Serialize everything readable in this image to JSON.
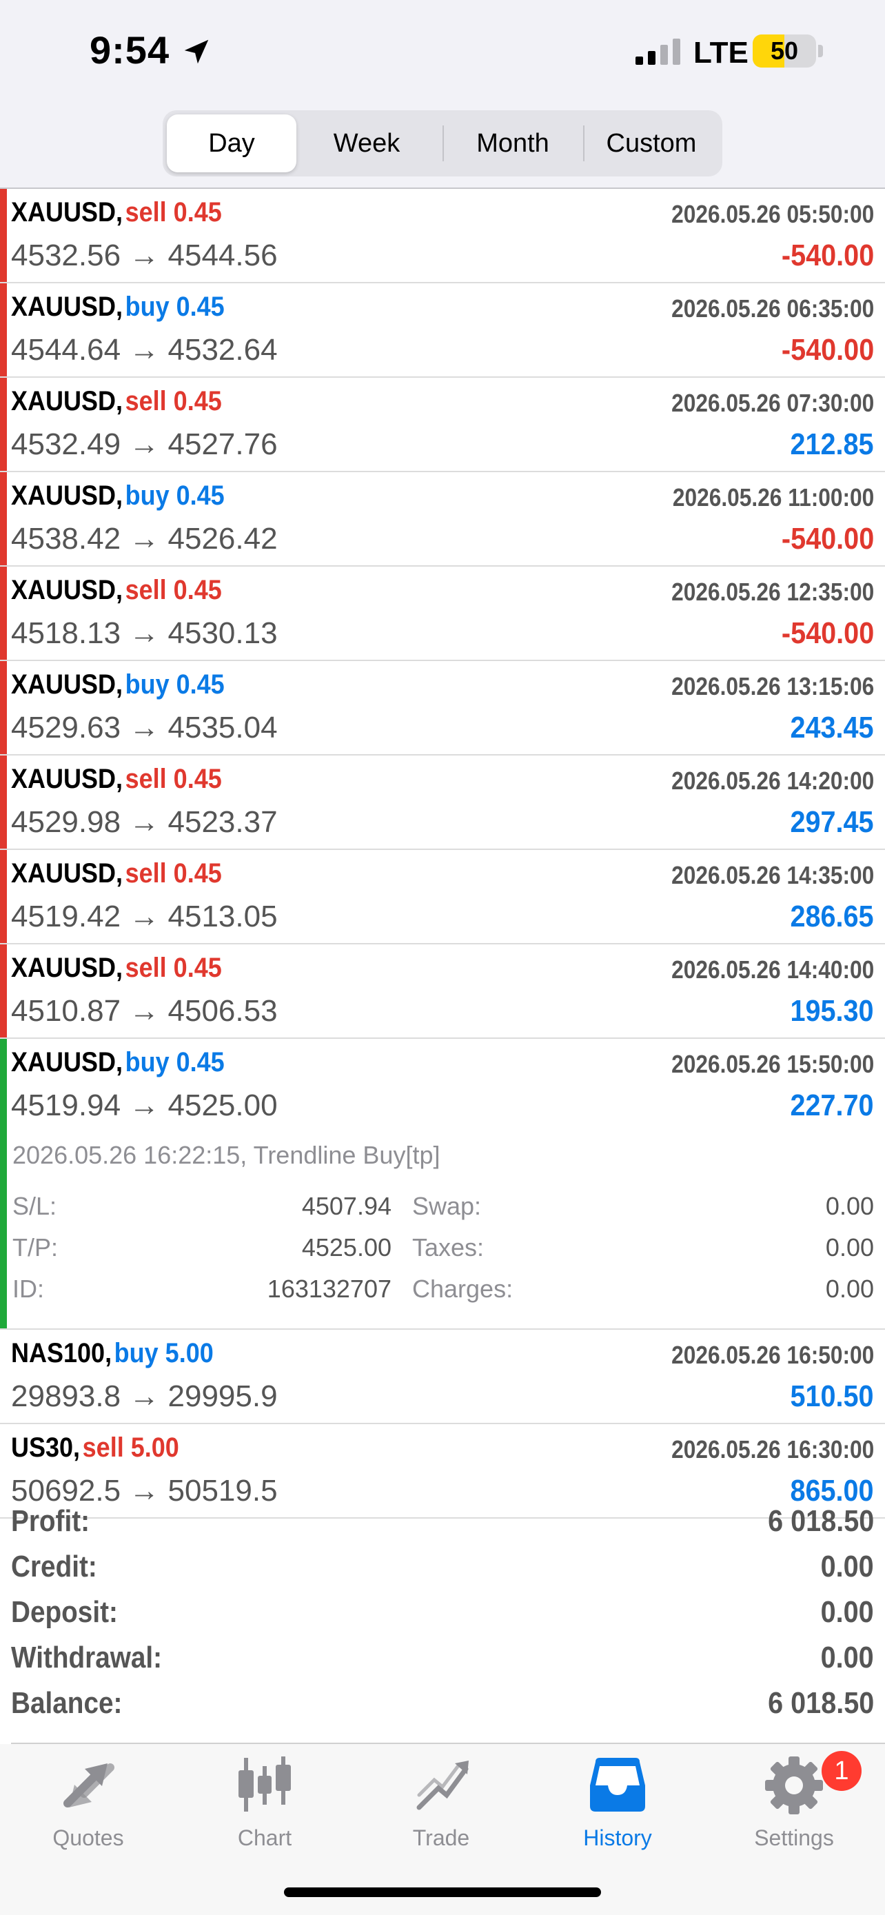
{
  "status_bar": {
    "time": "9:54",
    "network": "LTE",
    "battery": "50",
    "battery_level": 0.5
  },
  "periods": [
    {
      "label": "Day",
      "active": true
    },
    {
      "label": "Week",
      "active": false
    },
    {
      "label": "Month",
      "active": false
    },
    {
      "label": "Custom",
      "active": false
    }
  ],
  "deals": [
    {
      "symbol": "XAUUSD,",
      "side": "sell 0.45",
      "side_color": "red",
      "time": "2026.05.26 05:50:00",
      "prices": "4532.56 → 4544.56",
      "profit": "-540.00",
      "profit_color": "red",
      "bar": "#e0382e"
    },
    {
      "symbol": "XAUUSD,",
      "side": "buy 0.45",
      "side_color": "blue",
      "time": "2026.05.26 06:35:00",
      "prices": "4544.64 → 4532.64",
      "profit": "-540.00",
      "profit_color": "red",
      "bar": "#e0382e"
    },
    {
      "symbol": "XAUUSD,",
      "side": "sell 0.45",
      "side_color": "red",
      "time": "2026.05.26 07:30:00",
      "prices": "4532.49 → 4527.76",
      "profit": "212.85",
      "profit_color": "blue",
      "bar": "#e0382e"
    },
    {
      "symbol": "XAUUSD,",
      "side": "buy 0.45",
      "side_color": "blue",
      "time": "2026.05.26 11:00:00",
      "prices": "4538.42 → 4526.42",
      "profit": "-540.00",
      "profit_color": "red",
      "bar": "#e0382e"
    },
    {
      "symbol": "XAUUSD,",
      "side": "sell 0.45",
      "side_color": "red",
      "time": "2026.05.26 12:35:00",
      "prices": "4518.13 → 4530.13",
      "profit": "-540.00",
      "profit_color": "red",
      "bar": "#e0382e"
    },
    {
      "symbol": "XAUUSD,",
      "side": "buy 0.45",
      "side_color": "blue",
      "time": "2026.05.26 13:15:06",
      "prices": "4529.63 → 4535.04",
      "profit": "243.45",
      "profit_color": "blue",
      "bar": "#e0382e"
    },
    {
      "symbol": "XAUUSD,",
      "side": "sell 0.45",
      "side_color": "red",
      "time": "2026.05.26 14:20:00",
      "prices": "4529.98 → 4523.37",
      "profit": "297.45",
      "profit_color": "blue",
      "bar": "#e0382e"
    },
    {
      "symbol": "XAUUSD,",
      "side": "sell 0.45",
      "side_color": "red",
      "time": "2026.05.26 14:35:00",
      "prices": "4519.42 → 4513.05",
      "profit": "286.65",
      "profit_color": "blue",
      "bar": "#e0382e"
    },
    {
      "symbol": "XAUUSD,",
      "side": "sell 0.45",
      "side_color": "red",
      "time": "2026.05.26 14:40:00",
      "prices": "4510.87 → 4506.53",
      "profit": "195.30",
      "profit_color": "blue",
      "bar": "#e0382e"
    },
    {
      "symbol": "XAUUSD,",
      "side": "buy 0.45",
      "side_color": "blue",
      "time": "2026.05.26 15:50:00",
      "prices": "4519.94 → 4525.00",
      "profit": "227.70",
      "profit_color": "blue",
      "bar": "#1fa93a",
      "expanded": true
    },
    {
      "symbol": "NAS100,",
      "side": "buy 5.00",
      "side_color": "blue",
      "time": "2026.05.26 16:50:00",
      "prices": "29893.8 → 29995.9",
      "profit": "510.50",
      "profit_color": "blue",
      "bar": ""
    },
    {
      "symbol": "US30,",
      "side": "sell 5.00",
      "side_color": "red",
      "time": "2026.05.26 16:30:00",
      "prices": "50692.5 → 50519.5",
      "profit": "865.00",
      "profit_color": "blue",
      "bar": ""
    }
  ],
  "details": {
    "comment": "2026.05.26 16:22:15, Trendline Buy[tp]",
    "sl_label": "S/L:",
    "sl_value": "4507.94",
    "tp_label": "T/P:",
    "tp_value": "4525.00",
    "id_label": "ID:",
    "id_value": "163132707",
    "swap_label": "Swap:",
    "swap_value": "0.00",
    "taxes_label": "Taxes:",
    "taxes_value": "0.00",
    "charges_label": "Charges:",
    "charges_value": "0.00"
  },
  "summary": [
    {
      "label": "Profit:",
      "value": "6 018.50"
    },
    {
      "label": "Credit:",
      "value": "0.00"
    },
    {
      "label": "Deposit:",
      "value": "0.00"
    },
    {
      "label": "Withdrawal:",
      "value": "0.00"
    },
    {
      "label": "Balance:",
      "value": "6 018.50"
    }
  ],
  "tabs": [
    {
      "label": "Quotes",
      "icon": "quotes-icon",
      "active": false
    },
    {
      "label": "Chart",
      "icon": "chart-icon",
      "active": false
    },
    {
      "label": "Trade",
      "icon": "trade-icon",
      "active": false
    },
    {
      "label": "History",
      "icon": "history-icon",
      "active": true
    },
    {
      "label": "Settings",
      "icon": "settings-icon",
      "active": false,
      "badge": "1"
    }
  ],
  "colors": {
    "sell": "#e0382e",
    "buy": "#0a7ae6",
    "tp": "#1fa93a",
    "accent": "#0a7ae6"
  }
}
